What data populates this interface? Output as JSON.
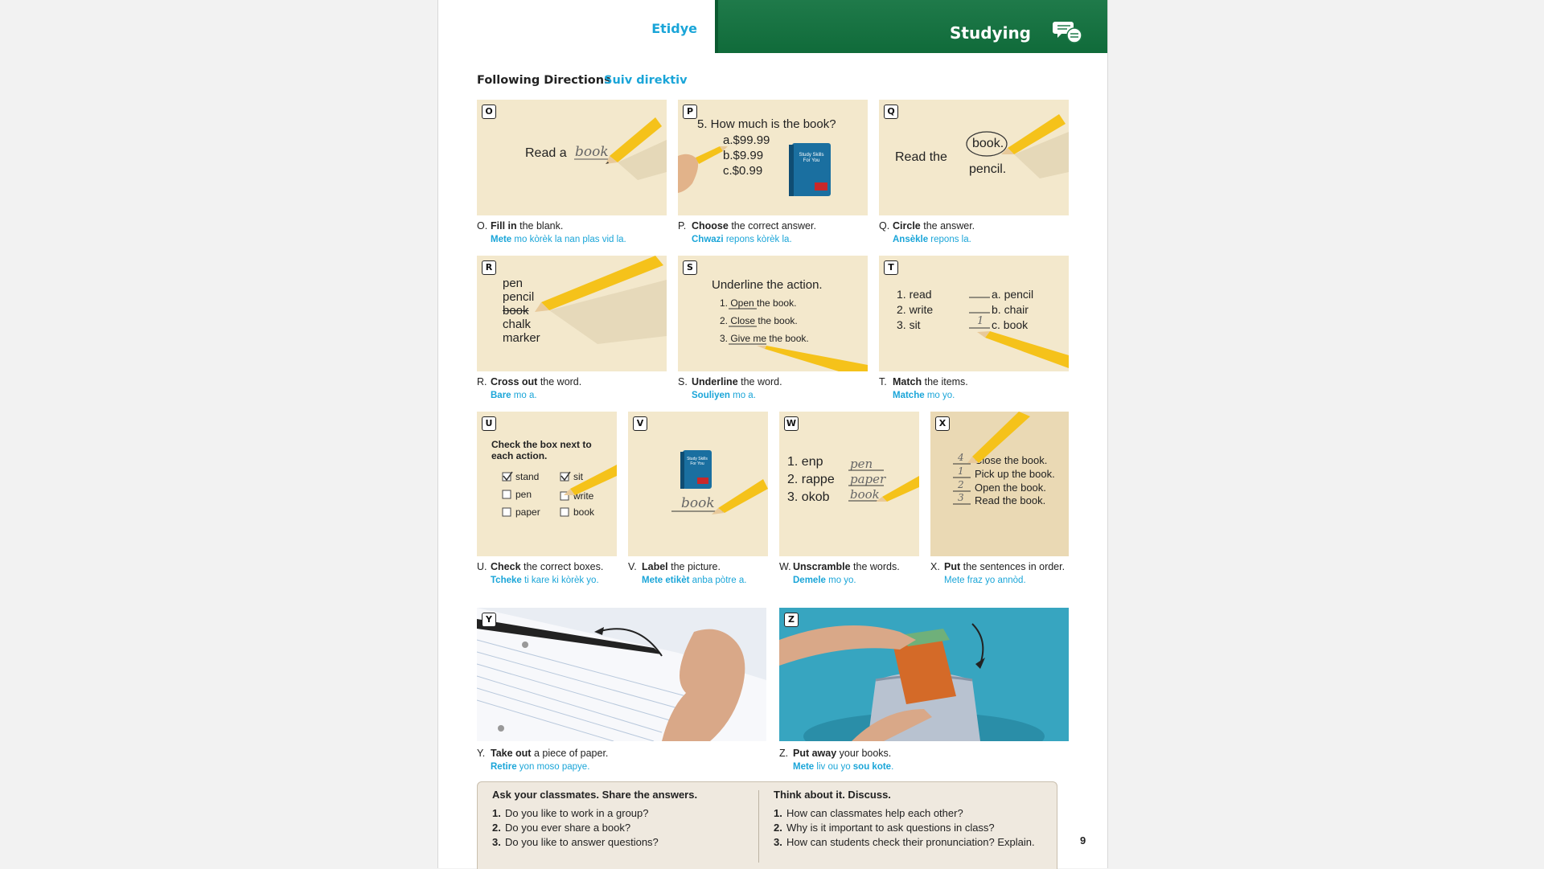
{
  "header": {
    "left_title": "Etidye",
    "right_title": "Studying",
    "icon": "chat-bubbles-icon"
  },
  "section": {
    "title": "Following Directions",
    "subtitle": "Suiv direktiv"
  },
  "panels": {
    "O": {
      "letter": "O",
      "text": "Read a",
      "handwriting": "book"
    },
    "P": {
      "letter": "P",
      "question": "5. How much is the book?",
      "a": "a.$99.99",
      "b": "b.$9.99",
      "c": "c.$0.99",
      "book_title": "Study Skills For You",
      "price": "$9.99"
    },
    "Q": {
      "letter": "Q",
      "text": "Read the",
      "circled": "book.",
      "other": "pencil."
    },
    "R": {
      "letter": "R",
      "words": [
        "pen",
        "pencil",
        "book",
        "chalk",
        "marker"
      ]
    },
    "S": {
      "letter": "S",
      "title": "Underline the action.",
      "items": [
        "1. Open the book.",
        "2. Close the book.",
        "3. Give me the book."
      ]
    },
    "T": {
      "letter": "T",
      "left": [
        "1. read",
        "2. write",
        "3. sit"
      ],
      "right": [
        "a. pencil",
        "b. chair",
        "c. book"
      ],
      "answer": "1"
    },
    "U": {
      "letter": "U",
      "title_1": "Check the box next to",
      "title_2": "each action.",
      "items": [
        "stand",
        "sit",
        "pen",
        "write",
        "paper",
        "book"
      ]
    },
    "V": {
      "letter": "V",
      "handwriting": "book",
      "book_title": "Study Skills For You",
      "price": "$9.99"
    },
    "W": {
      "letter": "W",
      "scrambled": [
        "1. enp",
        "2. rappe",
        "3. okob"
      ],
      "answers": [
        "pen",
        "paper",
        "book"
      ]
    },
    "X": {
      "letter": "X",
      "numbers": [
        "4",
        "1",
        "2",
        "3"
      ],
      "sentences": [
        "Close the book.",
        "Pick up the book.",
        "Open the book.",
        "Read the book."
      ]
    },
    "Y": {
      "letter": "Y"
    },
    "Z": {
      "letter": "Z"
    }
  },
  "captions": {
    "O": {
      "num": "O.",
      "bold": "Fill in",
      "rest": " the blank.",
      "tr_bold": "Mete",
      "tr_rest": " mo kòrèk la nan plas vid la."
    },
    "P": {
      "num": "P.",
      "bold": "Choose",
      "rest": " the correct answer.",
      "tr_bold": "Chwazi",
      "tr_rest": " repons kòrèk la."
    },
    "Q": {
      "num": "Q.",
      "bold": "Circle",
      "rest": " the answer.",
      "tr_bold": "Ansèkle",
      "tr_rest": " repons la."
    },
    "R": {
      "num": "R.",
      "bold": "Cross out",
      "rest": " the word.",
      "tr_bold": "Bare",
      "tr_rest": " mo a."
    },
    "S": {
      "num": "S.",
      "bold": "Underline",
      "rest": " the word.",
      "tr_bold": "Souliyen",
      "tr_rest": " mo a."
    },
    "T": {
      "num": "T.",
      "bold": "Match",
      "rest": " the items.",
      "tr_bold": "Matche",
      "tr_rest": " mo yo."
    },
    "U": {
      "num": "U.",
      "bold": "Check",
      "rest": " the correct boxes.",
      "tr_bold": "Tcheke",
      "tr_rest": " ti kare ki kòrèk yo."
    },
    "V": {
      "num": "V.",
      "bold": "Label",
      "rest": " the picture.",
      "tr_bold": "Mete etikèt",
      "tr_rest": " anba pòtre a."
    },
    "W": {
      "num": "W.",
      "bold": "Unscramble",
      "rest": " the words.",
      "tr_bold": "Demele",
      "tr_rest": " mo yo."
    },
    "X": {
      "num": "X.",
      "bold": "Put",
      "rest": " the sentences in order.",
      "tr_bold": "",
      "tr_rest": "Mete fraz yo annòd."
    },
    "Y": {
      "num": "Y.",
      "bold": "Take out",
      "rest": " a piece of paper.",
      "tr_bold": "Retire",
      "tr_rest": " yon moso papye."
    },
    "Z": {
      "num": "Z.",
      "bold": "Put away",
      "rest": " your books.",
      "tr_bold": "Mete",
      "tr_rest": " liv ou yo ",
      "tr_bold2": "sou kote",
      "tr_end": "."
    }
  },
  "ask": {
    "title": "Ask your classmates. Share the answers.",
    "questions": [
      "Do you like to work in a group?",
      "Do you ever share a book?",
      "Do you like to answer questions?"
    ]
  },
  "think": {
    "title": "Think about it. Discuss.",
    "questions": [
      "How can classmates help each other?",
      "Why is it important to ask questions in class?",
      "How can students check their pronunciation? Explain."
    ]
  },
  "page_number": "9",
  "colors": {
    "accent": "#1aa5d8",
    "header_green": "#1f7a4a",
    "panel": "#f3e8cc",
    "pencil": "#f5c21a"
  }
}
